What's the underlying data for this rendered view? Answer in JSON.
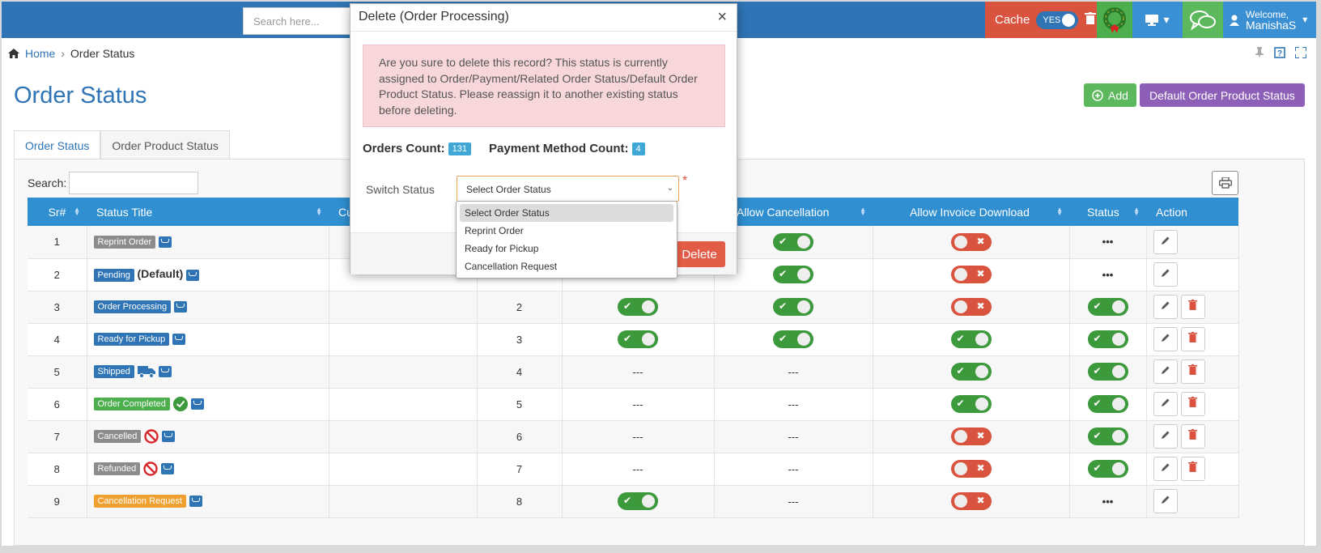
{
  "topbar": {
    "search_placeholder": "Search here...",
    "cache_label": "Cache",
    "cache_toggle": "YES",
    "welcome": "Welcome,",
    "user": "ManishaS"
  },
  "breadcrumb": {
    "home": "Home",
    "sep": "›",
    "current": "Order Status"
  },
  "page": {
    "title": "Order Status",
    "add_button": "Add",
    "default_button": "Default Order Product Status",
    "tabs": [
      "Order Status",
      "Order Product Status"
    ],
    "search_label": "Search:"
  },
  "table": {
    "headers": [
      "Sr#",
      "Status Title",
      "Cu",
      "",
      "",
      "Allow Cancellation",
      "Allow Invoice Download",
      "Status",
      "Action"
    ],
    "rows": [
      {
        "sr": "1",
        "title": "Reprint Order",
        "color": "#8c8c8c",
        "default": "",
        "extra": "",
        "order": "",
        "t1": "",
        "cancel": "on",
        "invoice": "off",
        "status": "dots",
        "del": false
      },
      {
        "sr": "2",
        "title": "Pending",
        "color": "#2f74b5",
        "default": "(Default)",
        "extra": "",
        "order": "",
        "t1": "",
        "cancel": "on",
        "invoice": "off",
        "status": "dots",
        "del": false
      },
      {
        "sr": "3",
        "title": "Order Processing",
        "color": "#2f74b5",
        "default": "",
        "extra": "",
        "order": "2",
        "t1": "on",
        "cancel": "on",
        "invoice": "off",
        "status": "on",
        "del": true
      },
      {
        "sr": "4",
        "title": "Ready for Pickup",
        "color": "#2f74b5",
        "default": "",
        "extra": "",
        "order": "3",
        "t1": "on",
        "cancel": "on",
        "invoice": "on",
        "status": "on",
        "del": true
      },
      {
        "sr": "5",
        "title": "Shipped",
        "color": "#2f74b5",
        "default": "",
        "extra": "truck",
        "order": "4",
        "t1": "---",
        "cancel": "---",
        "invoice": "on",
        "status": "on",
        "del": true
      },
      {
        "sr": "6",
        "title": "Order Completed",
        "color": "#4cae4c",
        "default": "",
        "extra": "check",
        "order": "5",
        "t1": "---",
        "cancel": "---",
        "invoice": "on",
        "status": "on",
        "del": true
      },
      {
        "sr": "7",
        "title": "Cancelled",
        "color": "#8c8c8c",
        "default": "",
        "extra": "ban",
        "order": "6",
        "t1": "---",
        "cancel": "---",
        "invoice": "off",
        "status": "on",
        "del": true
      },
      {
        "sr": "8",
        "title": "Refunded",
        "color": "#8c8c8c",
        "default": "",
        "extra": "ban",
        "order": "7",
        "t1": "---",
        "cancel": "---",
        "invoice": "off",
        "status": "on",
        "del": true
      },
      {
        "sr": "9",
        "title": "Cancellation Request",
        "color": "#f0a030",
        "default": "",
        "extra": "",
        "order": "8",
        "t1": "on",
        "cancel": "---",
        "invoice": "off",
        "status": "dots",
        "del": false
      }
    ]
  },
  "modal": {
    "title": "Delete (Order Processing)",
    "close": "×",
    "alert": "Are you sure to delete this record? This status is currently assigned to Order/Payment/Related Order Status/Default Order Product Status. Please reassign it to another existing status before deleting.",
    "orders_count_label": "Orders Count:",
    "orders_count": "131",
    "payment_count_label": "Payment Method Count:",
    "payment_count": "4",
    "switch_label": "Switch Status",
    "select_value": "Select Order Status",
    "required": "*",
    "delete_button": "Delete",
    "options": [
      "Select Order Status",
      "Reprint Order",
      "Ready for Pickup",
      "Cancellation Request"
    ]
  }
}
